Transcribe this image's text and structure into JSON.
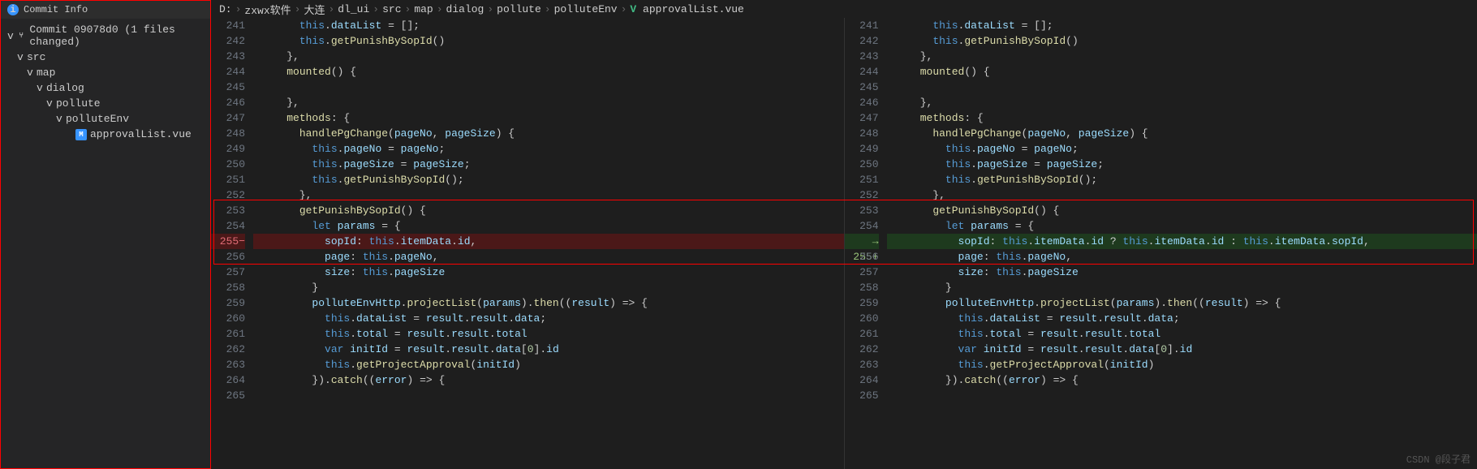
{
  "sidebar": {
    "title": "Commit Info",
    "commit": "Commit 09078d0",
    "changed": "(1 files changed)",
    "tree": [
      {
        "indent": 0,
        "chev": "v",
        "icon": "fork",
        "label": "Commit 09078d0   (1 files changed)",
        "name": "commit-node"
      },
      {
        "indent": 1,
        "chev": "v",
        "label": "src",
        "name": "folder-src"
      },
      {
        "indent": 2,
        "chev": "v",
        "label": "map",
        "name": "folder-map"
      },
      {
        "indent": 3,
        "chev": "v",
        "label": "dialog",
        "name": "folder-dialog"
      },
      {
        "indent": 4,
        "chev": "v",
        "label": "pollute",
        "name": "folder-pollute"
      },
      {
        "indent": 5,
        "chev": "v",
        "label": "polluteEnv",
        "name": "folder-polluteenv"
      },
      {
        "indent": 6,
        "chev": "",
        "icon": "M",
        "label": "approvalList.vue",
        "name": "file-approvallist"
      }
    ]
  },
  "breadcrumb": [
    "D:",
    "zxwx软件",
    "大连",
    "dl_ui",
    "src",
    "map",
    "dialog",
    "pollute",
    "polluteEnv",
    "approvalList.vue"
  ],
  "diff": {
    "lines_left": [
      {
        "n": 241,
        "t": "      this.dataList = [];"
      },
      {
        "n": 242,
        "t": "      this.getPunishBySopId()"
      },
      {
        "n": 243,
        "t": "    },"
      },
      {
        "n": 244,
        "t": "    mounted() {"
      },
      {
        "n": 245,
        "t": ""
      },
      {
        "n": 246,
        "t": "    },"
      },
      {
        "n": 247,
        "t": "    methods: {"
      },
      {
        "n": 248,
        "t": "      handlePgChange(pageNo, pageSize) {"
      },
      {
        "n": 249,
        "t": "        this.pageNo = pageNo;"
      },
      {
        "n": 250,
        "t": "        this.pageSize = pageSize;"
      },
      {
        "n": 251,
        "t": "        this.getPunishBySopId();"
      },
      {
        "n": 252,
        "t": "      },"
      },
      {
        "n": 253,
        "t": "      getPunishBySopId() {"
      },
      {
        "n": 254,
        "t": "        let params = {"
      },
      {
        "n": "255−",
        "t": "          sopId: this.itemData.id,",
        "cls": "removed"
      },
      {
        "n": 256,
        "t": "          page: this.pageNo,"
      },
      {
        "n": 257,
        "t": "          size: this.pageSize"
      },
      {
        "n": 258,
        "t": "        }"
      },
      {
        "n": 259,
        "t": "        polluteEnvHttp.projectList(params).then((result) => {"
      },
      {
        "n": 260,
        "t": "          this.dataList = result.result.data;"
      },
      {
        "n": 261,
        "t": "          this.total = result.result.total"
      },
      {
        "n": 262,
        "t": "          var initId = result.result.data[0].id"
      },
      {
        "n": 263,
        "t": "          this.getProjectApproval(initId)"
      },
      {
        "n": 264,
        "t": "        }).catch((error) => {"
      },
      {
        "n": 265,
        "t": ""
      }
    ],
    "lines_right": [
      {
        "n": 241,
        "t": "      this.dataList = [];"
      },
      {
        "n": 242,
        "t": "      this.getPunishBySopId()"
      },
      {
        "n": 243,
        "t": "    },"
      },
      {
        "n": 244,
        "t": "    mounted() {"
      },
      {
        "n": 245,
        "t": ""
      },
      {
        "n": 246,
        "t": "    },"
      },
      {
        "n": 247,
        "t": "    methods: {"
      },
      {
        "n": 248,
        "t": "      handlePgChange(pageNo, pageSize) {"
      },
      {
        "n": 249,
        "t": "        this.pageNo = pageNo;"
      },
      {
        "n": 250,
        "t": "        this.pageSize = pageSize;"
      },
      {
        "n": 251,
        "t": "        this.getPunishBySopId();"
      },
      {
        "n": 252,
        "t": "      },"
      },
      {
        "n": 253,
        "t": "      getPunishBySopId() {"
      },
      {
        "n": 254,
        "t": "        let params = {"
      },
      {
        "n": "255+",
        "t": "          sopId: this.itemData.id ? this.itemData.id : this.itemData.sopId,",
        "cls": "added",
        "arrow": "→"
      },
      {
        "n": 256,
        "t": "          page: this.pageNo,"
      },
      {
        "n": 257,
        "t": "          size: this.pageSize"
      },
      {
        "n": 258,
        "t": "        }"
      },
      {
        "n": 259,
        "t": "        polluteEnvHttp.projectList(params).then((result) => {"
      },
      {
        "n": 260,
        "t": "          this.dataList = result.result.data;"
      },
      {
        "n": 261,
        "t": "          this.total = result.result.total"
      },
      {
        "n": 262,
        "t": "          var initId = result.result.data[0].id"
      },
      {
        "n": 263,
        "t": "          this.getProjectApproval(initId)"
      },
      {
        "n": 264,
        "t": "        }).catch((error) => {"
      },
      {
        "n": 265,
        "t": ""
      }
    ]
  },
  "watermark": "CSDN @段子君"
}
